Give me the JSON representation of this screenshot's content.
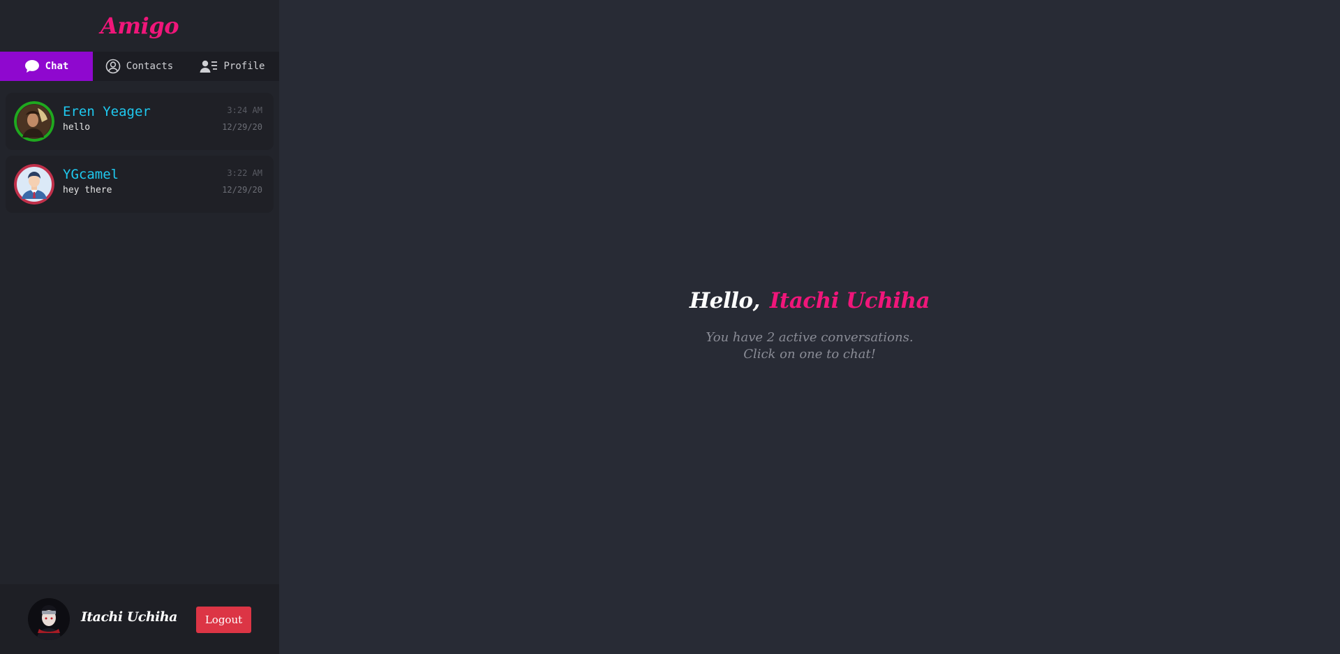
{
  "app": {
    "brand": "Amigo"
  },
  "tabs": [
    {
      "label": "Chat",
      "icon": "chat-bubble-icon",
      "active": true
    },
    {
      "label": "Contacts",
      "icon": "user-circle-icon",
      "active": false
    },
    {
      "label": "Profile",
      "icon": "profile-card-icon",
      "active": false
    }
  ],
  "chats": [
    {
      "name": "Eren Yeager",
      "message": "hello",
      "time": "3:24 AM",
      "date": "12/29/20",
      "ring_color": "#1fa81f",
      "avatar": "eren-avatar"
    },
    {
      "name": "YGcamel",
      "message": "hey there",
      "time": "3:22 AM",
      "date": "12/29/20",
      "ring_color": "#c0304a",
      "avatar": "businessman-avatar"
    }
  ],
  "user": {
    "name": "Itachi Uchiha",
    "logout_label": "Logout"
  },
  "welcome": {
    "hello": "Hello,",
    "name": "Itachi Uchiha",
    "line1": "You have 2 active conversations.",
    "line2": "Click on one to chat!"
  },
  "colors": {
    "accent_pink": "#f0167a",
    "active_tab": "#8f08cf",
    "chat_name": "#1fc9f0",
    "logout": "#dc3545"
  }
}
